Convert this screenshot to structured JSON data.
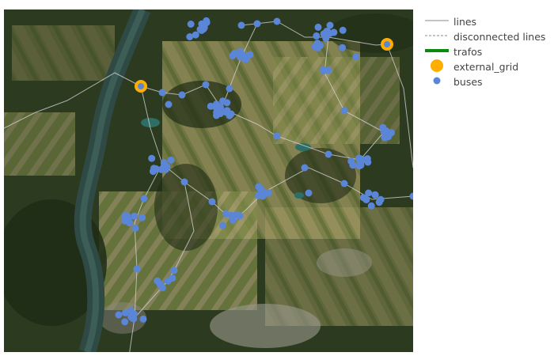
{
  "map": {
    "basemap": "satellite",
    "colors": {
      "line": "#cfcfcf",
      "bus": "#5b86d8",
      "external_grid": "#ffae00",
      "trafo": "#0a8a0a"
    }
  },
  "legend": {
    "items": [
      {
        "key": "lines",
        "label": "lines",
        "icon": "solid-line"
      },
      {
        "key": "disconnected_lines",
        "label": "disconnected lines",
        "icon": "dashed-line"
      },
      {
        "key": "trafos",
        "label": "trafos",
        "icon": "thick-green-line"
      },
      {
        "key": "external_grid",
        "label": "external_grid",
        "icon": "orange-ring"
      },
      {
        "key": "buses",
        "label": "buses",
        "icon": "blue-dot"
      }
    ]
  }
}
